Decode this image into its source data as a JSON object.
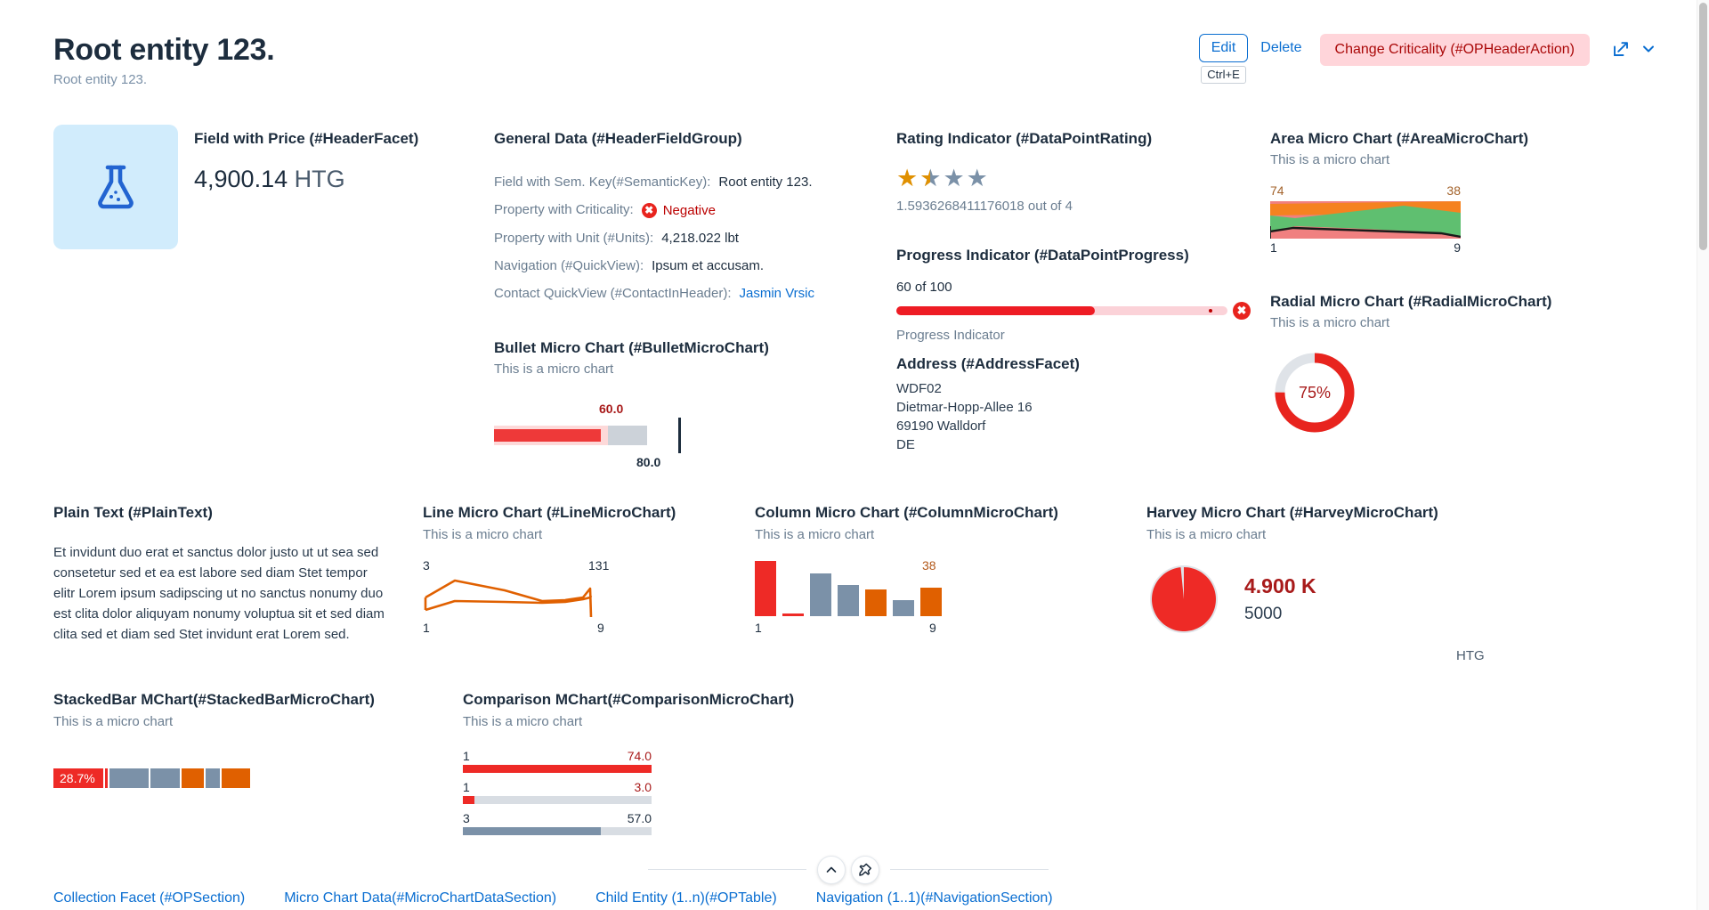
{
  "header": {
    "title": "Root entity 123.",
    "subtitle": "Root entity 123.",
    "actions": {
      "edit_label": "Edit",
      "edit_shortcut": "Ctrl+E",
      "delete_label": "Delete",
      "criticality_label": "Change Criticality (#OPHeaderAction)",
      "share_icon": "share-icon",
      "overflow_icon": "chevron-down-icon"
    },
    "colors": {
      "link": "#0a6ed1",
      "critical_text": "#aa0808",
      "critical_bg": "#ffd5da",
      "negative": "#e8241e",
      "title": "#1d2d3e"
    }
  },
  "image_facet": {
    "icon": "lab-flask-icon",
    "background": "#d1ecfc",
    "icon_color": "#2264d1"
  },
  "price_facet": {
    "title": "Field with Price (#HeaderFacet)",
    "amount": "4,900.14",
    "currency": "HTG"
  },
  "general_data": {
    "title": "General Data (#HeaderFieldGroup)",
    "rows": [
      {
        "label": "Field with Sem. Key(#SemanticKey):",
        "value": "Root entity 123.",
        "kind": "text"
      },
      {
        "label": "Property with Criticality:",
        "value": "Negative",
        "kind": "negative",
        "icon": "error-icon"
      },
      {
        "label": "Property with Unit (#Units):",
        "value": "4,218.022 lbt",
        "kind": "text"
      },
      {
        "label": "Navigation (#QuickView):",
        "value": "Ipsum et accusam.",
        "kind": "text"
      },
      {
        "label": "Contact QuickView (#ContactInHeader):",
        "value": "Jasmin Vrsic",
        "kind": "link"
      }
    ]
  },
  "bullet_chart": {
    "title": "Bullet Micro Chart (#BulletMicroChart)",
    "subtitle": "This is a micro chart",
    "chart_data": {
      "type": "bar",
      "actual": 60.0,
      "target": 80.0,
      "actual_label": "60.0",
      "target_label": "80.0",
      "scale_max": 100,
      "actual_color": "#ee3939",
      "forecast_color": "#fdd9d9",
      "track_color": "#ccd2d9"
    }
  },
  "rating": {
    "title": "Rating Indicator (#DataPointRating)",
    "value": 1.5936268411176018,
    "max": 4,
    "text": "1.5936268411176018 out of 4",
    "star_color": "#e09000",
    "empty_color": "#7b91a8",
    "stars": [
      "full",
      "half",
      "empty",
      "empty"
    ]
  },
  "progress": {
    "title": "Progress Indicator (#DataPointProgress)",
    "value_text": "60 of 100",
    "value": 60,
    "max": 100,
    "footer_label": "Progress Indicator",
    "fill_color": "#ee1c24",
    "track_color": "#fbd2d8",
    "status_icon": "error-icon"
  },
  "address": {
    "title": "Address (#AddressFacet)",
    "lines": [
      "WDF02",
      "Dietmar-Hopp-Allee 16",
      "69190 Walldorf",
      "DE"
    ]
  },
  "area_chart": {
    "title": "Area Micro Chart (#AreaMicroChart)",
    "subtitle": "This is a micro chart",
    "chart_data": {
      "type": "area",
      "x": [
        1,
        9
      ],
      "label_top_left": "74",
      "label_top_right": "38",
      "label_bottom_left": "1",
      "label_bottom_right": "9",
      "bands": [
        {
          "name": "error-upper",
          "color": "#f08080"
        },
        {
          "name": "warning",
          "color": "#f58220"
        },
        {
          "name": "good",
          "color": "#5fbf70"
        },
        {
          "name": "error-lower",
          "color": "#f08080"
        }
      ],
      "line_color": "#1a1a1a"
    }
  },
  "radial_chart": {
    "title": "Radial Micro Chart (#RadialMicroChart)",
    "subtitle": "This is a micro chart",
    "chart_data": {
      "type": "pie",
      "percentage": 75,
      "label": "75%",
      "fill_color": "#e8241e",
      "rest_color": "#dfe3e8"
    }
  },
  "plain_text": {
    "title": "Plain Text (#PlainText)",
    "body": "Et invidunt duo erat et sanctus dolor justo ut ut sea sed consetetur sed et ea est labore sed diam Stet tempor elitr Lorem ipsum sadipscing ut no sanctus nonumy duo est clita dolor aliquyam nonumy voluptua sit et sed diam clita sed et diam sed Stet invidunt erat Lorem sed."
  },
  "line_chart": {
    "title": "Line Micro Chart (#LineMicroChart)",
    "subtitle": "This is a micro chart",
    "chart_data": {
      "type": "line",
      "label_top_left": "3",
      "label_top_right": "131",
      "label_bottom_left": "1",
      "label_bottom_right": "9",
      "ylim": [
        3,
        131
      ],
      "x": [
        1,
        2,
        3,
        4,
        5,
        6,
        7,
        8,
        9
      ],
      "series": [
        {
          "name": "series-1",
          "color": "#e06000",
          "values": [
            58,
            74,
            110,
            96,
            84,
            72,
            66,
            76,
            80
          ]
        },
        {
          "name": "series-2",
          "color": "#e06000",
          "values": [
            38,
            52,
            70,
            68,
            66,
            64,
            62,
            70,
            86
          ]
        }
      ]
    }
  },
  "column_chart": {
    "title": "Column Micro Chart (#ColumnMicroChart)",
    "subtitle": "This is a micro chart",
    "chart_data": {
      "type": "bar",
      "label_top_left": "74",
      "label_top_right": "38",
      "label_bottom_left": "1",
      "label_bottom_right": "9",
      "categories": [
        "1",
        "2",
        "3",
        "4",
        "5",
        "6",
        "9"
      ],
      "values": [
        74,
        3,
        57,
        42,
        36,
        22,
        38
      ],
      "colors": [
        "#ee2a26",
        "#ee2a26",
        "#7b91a8",
        "#7b91a8",
        "#e06000",
        "#7b91a8",
        "#e06000"
      ]
    }
  },
  "harvey_chart": {
    "title": "Harvey Micro Chart (#HarveyMicroChart)",
    "subtitle": "This is a micro chart",
    "chart_data": {
      "type": "pie",
      "percentage": 98,
      "value_label": "4.900 K",
      "total_label": "5000",
      "unit": "HTG",
      "fill_color": "#ee2a26",
      "rest_color": "#dfe3e8"
    }
  },
  "stacked_bar": {
    "title": "StackedBar MChart(#StackedBarMicroChart)",
    "subtitle": "This is a micro chart",
    "chart_data": {
      "type": "bar",
      "first_label": "28.7%",
      "segments": [
        {
          "name": "seg-1",
          "width": 28.7,
          "color": "#ee2a26",
          "label": "28.7%"
        },
        {
          "name": "seg-2",
          "width": 1.5,
          "color": "#ee2a26",
          "label": ""
        },
        {
          "name": "seg-3",
          "width": 22.0,
          "color": "#7b91a8",
          "label": ""
        },
        {
          "name": "seg-4",
          "width": 17.0,
          "color": "#7b91a8",
          "label": ""
        },
        {
          "name": "seg-5",
          "width": 12.5,
          "color": "#e06000",
          "label": ""
        },
        {
          "name": "seg-6",
          "width": 8.5,
          "color": "#7b91a8",
          "label": ""
        },
        {
          "name": "seg-7",
          "width": 16.0,
          "color": "#e06000",
          "label": ""
        }
      ]
    }
  },
  "comparison_chart": {
    "title": "Comparison MChart(#ComparisonMicroChart)",
    "subtitle": "This is a micro chart",
    "chart_data": {
      "type": "bar",
      "rows": [
        {
          "name": "1",
          "value": 74.0,
          "value_label": "74.0",
          "pct": 100,
          "color": "#ee2a26"
        },
        {
          "name": "1",
          "value": 3.0,
          "value_label": "3.0",
          "pct": 6,
          "color": "#ee2a26"
        },
        {
          "name": "3",
          "value": 57.0,
          "value_label": "57.0",
          "pct": 73,
          "color": "#7b91a8"
        }
      ],
      "track_color": "#d8dde3"
    }
  },
  "footer": {
    "collapse_icon": "chevron-up-icon",
    "pin_icon": "pin-icon",
    "anchors": [
      {
        "label": "Collection Facet (#OPSection)",
        "active": true
      },
      {
        "label": "Micro Chart Data(#MicroChartDataSection)",
        "active": false
      },
      {
        "label": "Child Entity (1..n)(#OPTable)",
        "active": false
      },
      {
        "label": "Navigation (1..1)(#NavigationSection)",
        "active": false
      }
    ]
  }
}
